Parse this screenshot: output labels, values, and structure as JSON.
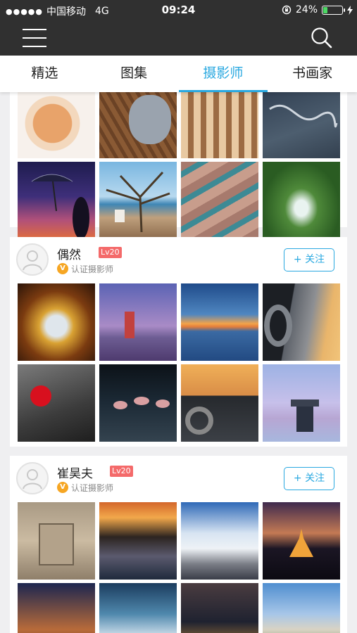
{
  "status_bar": {
    "signal_dots": "●●●●●",
    "carrier": "中国移动",
    "network": "4G",
    "time": "09:24",
    "battery_percent": "24%",
    "battery_level": 0.24,
    "lock_icon": "rotation-lock-icon",
    "charge_icon": "lightning-icon"
  },
  "nav": {
    "menu_icon": "hamburger-menu-icon",
    "search_icon": "search-icon"
  },
  "tabs": [
    {
      "label": "精选",
      "active": false
    },
    {
      "label": "图集",
      "active": false
    },
    {
      "label": "摄影师",
      "active": true
    },
    {
      "label": "书画家",
      "active": false
    }
  ],
  "colors": {
    "accent": "#29a8e0",
    "level_badge": "#f46a6a",
    "verified_badge": "#f6a623",
    "header_bg": "#303030"
  },
  "photographers": [
    {
      "name": "偶然",
      "level": "Lv20",
      "verified_badge": "V",
      "verified_text": "认证摄影师",
      "follow_label": "+ 关注"
    },
    {
      "name": "崔昊夫",
      "level": "Lv20",
      "verified_badge": "V",
      "verified_text": "认证摄影师",
      "follow_label": "+ 关注"
    }
  ]
}
